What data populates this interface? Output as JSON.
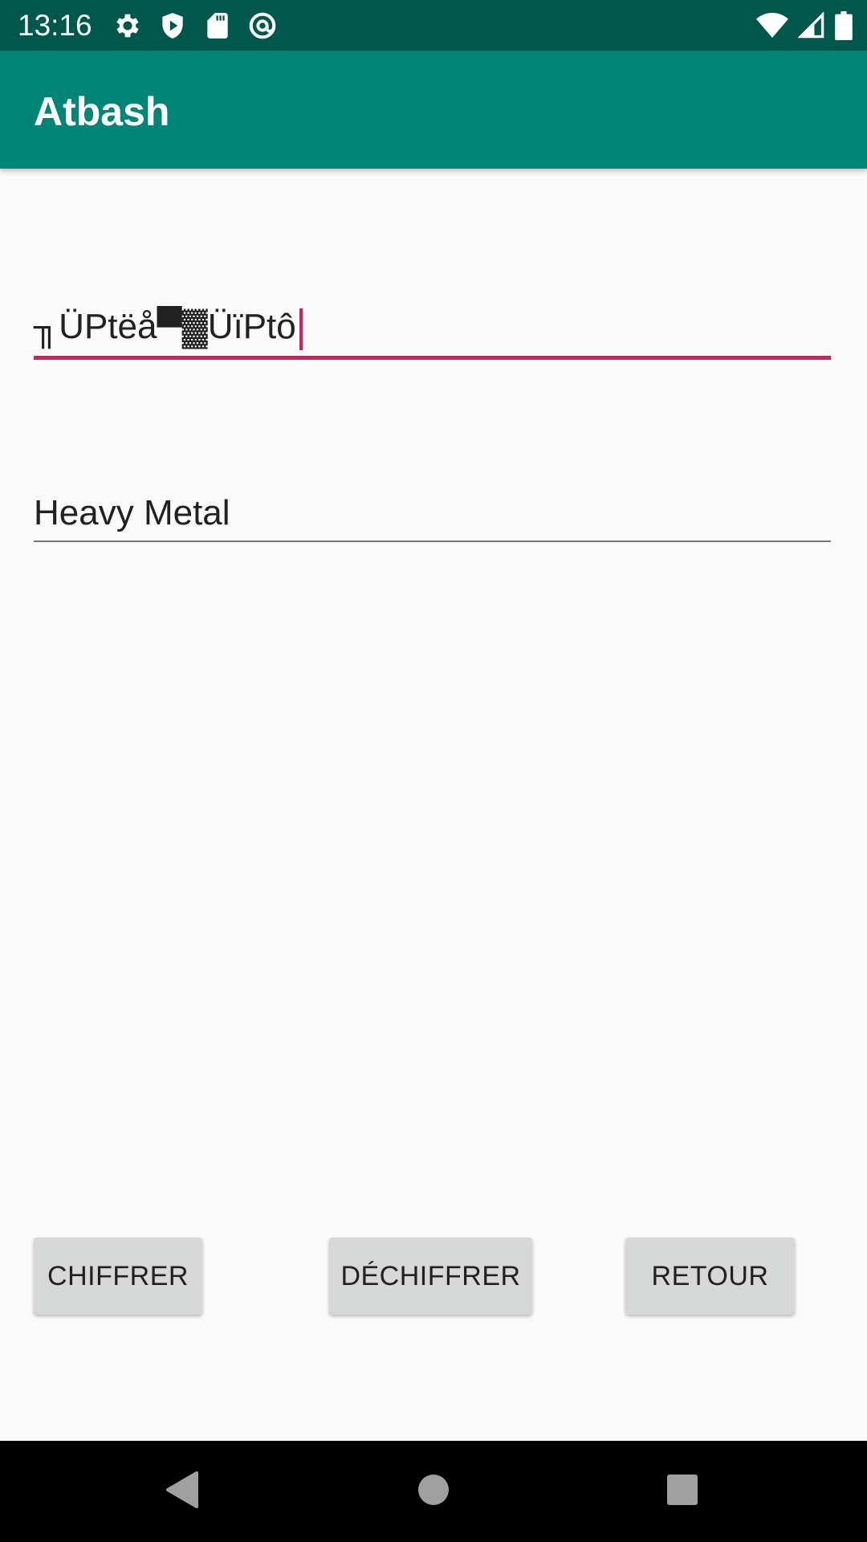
{
  "status_bar": {
    "time": "13:16",
    "left_icons": [
      "settings-icon",
      "shield-play-icon",
      "sd-card-icon",
      "at-sign-icon"
    ],
    "right_icons": [
      "wifi-icon",
      "cell-signal-icon",
      "battery-icon"
    ]
  },
  "app_bar": {
    "title": "Atbash"
  },
  "input": {
    "value": "╖ÜPtëå▀▓ÜïPtô",
    "focused": true
  },
  "output": {
    "value": "Heavy Metal"
  },
  "buttons": {
    "encrypt": "CHIFFRER",
    "decrypt": "DÉCHIFFRER",
    "back": "RETOUR"
  },
  "nav_bar": {
    "icons": [
      "back-icon",
      "home-icon",
      "recents-icon"
    ]
  },
  "colors": {
    "status_bar": "#00574b",
    "app_bar": "#008577",
    "accent": "#d81b60",
    "background": "#fafafa",
    "button": "#d6d7d7"
  }
}
